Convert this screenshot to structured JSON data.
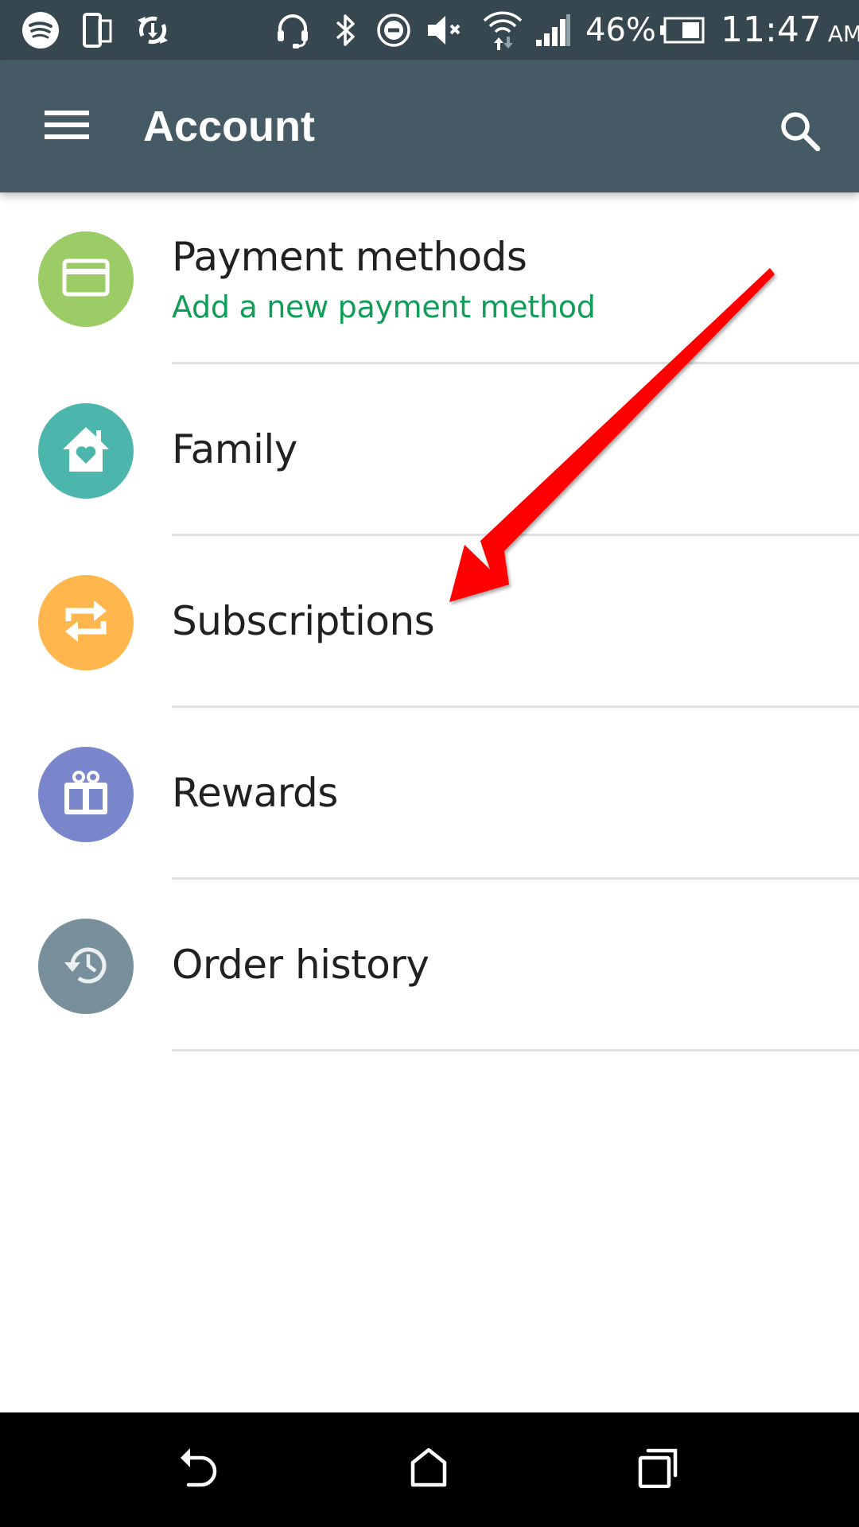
{
  "status_bar": {
    "left_icons": [
      "spotify-icon",
      "device-transfer-icon",
      "sync-download-icon"
    ],
    "right_icons": [
      "headset-icon",
      "bluetooth-icon",
      "do-not-disturb-icon",
      "volume-muted-icon",
      "wifi-icon",
      "cellular-signal-icon",
      "battery-icon"
    ],
    "battery_percent": "46%",
    "battery_level": 0.46,
    "time": "11:47",
    "ampm": "AM"
  },
  "toolbar": {
    "title": "Account",
    "menu_icon": "hamburger-menu-icon",
    "search_icon": "search-icon"
  },
  "list": {
    "items": [
      {
        "id": "payment-methods",
        "title": "Payment methods",
        "subtitle": "Add a new payment method",
        "icon": "credit-card-icon",
        "color": "#9ccc65"
      },
      {
        "id": "family",
        "title": "Family",
        "subtitle": null,
        "icon": "family-house-heart-icon",
        "color": "#4db6ac"
      },
      {
        "id": "subscriptions",
        "title": "Subscriptions",
        "subtitle": null,
        "icon": "subscriptions-repeat-icon",
        "color": "#ffb74d"
      },
      {
        "id": "rewards",
        "title": "Rewards",
        "subtitle": null,
        "icon": "gift-icon",
        "color": "#7986cb"
      },
      {
        "id": "order-history",
        "title": "Order history",
        "subtitle": null,
        "icon": "history-clock-icon",
        "color": "#78909c"
      }
    ]
  },
  "annotation": {
    "type": "red-arrow",
    "points_to": "subscriptions",
    "color": "#ff0000"
  },
  "nav_bar": {
    "buttons": [
      "back-icon",
      "home-icon",
      "recents-icon"
    ]
  },
  "colors": {
    "status_bar": "#37474f",
    "toolbar": "#455a64",
    "subtitle_green": "#0f9d58",
    "divider": "#e0e0e0"
  }
}
